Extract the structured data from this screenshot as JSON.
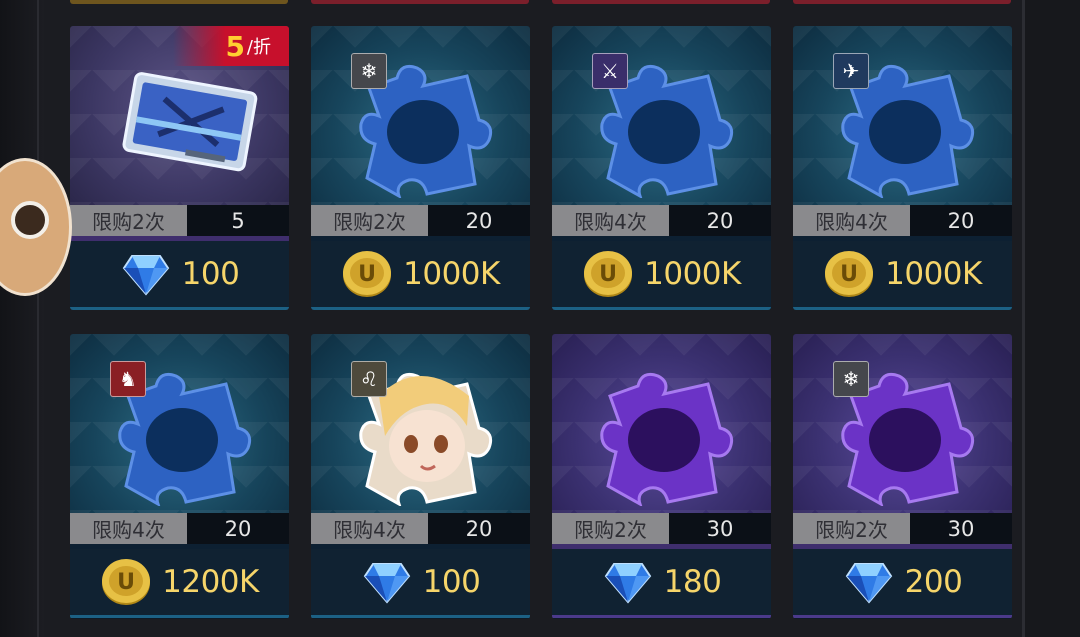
{
  "discount": {
    "num": "5",
    "unit": "/折"
  },
  "items": [
    {
      "limit": "限购2次",
      "qty": "5",
      "currency": "gem",
      "price": "100",
      "art": "ticket",
      "badge": ""
    },
    {
      "limit": "限购2次",
      "qty": "20",
      "currency": "coin",
      "price": "1000K",
      "art": "blue-piece",
      "badge": "snowflake"
    },
    {
      "limit": "限购4次",
      "qty": "20",
      "currency": "coin",
      "price": "1000K",
      "art": "blue-piece",
      "badge": "sword"
    },
    {
      "limit": "限购4次",
      "qty": "20",
      "currency": "coin",
      "price": "1000K",
      "art": "blue-piece",
      "badge": "wing"
    },
    {
      "limit": "限购4次",
      "qty": "20",
      "currency": "coin",
      "price": "1200K",
      "art": "blue-piece",
      "badge": "horse"
    },
    {
      "limit": "限购4次",
      "qty": "20",
      "currency": "gem",
      "price": "100",
      "art": "portrait-piece",
      "badge": "lion"
    },
    {
      "limit": "限购2次",
      "qty": "30",
      "currency": "gem",
      "price": "180",
      "art": "purple-piece",
      "badge": ""
    },
    {
      "limit": "限购2次",
      "qty": "30",
      "currency": "gem",
      "price": "200",
      "art": "purple-piece",
      "badge": "snowflake"
    }
  ],
  "icons": {
    "gem": "gem-icon",
    "coin": "coin-icon",
    "coin_letter": "U",
    "mascot": "owl-mascot"
  },
  "colors": {
    "price_text": "#f6d56a",
    "discount_bg": "#c7102c",
    "discount_num": "#ffcf31"
  }
}
